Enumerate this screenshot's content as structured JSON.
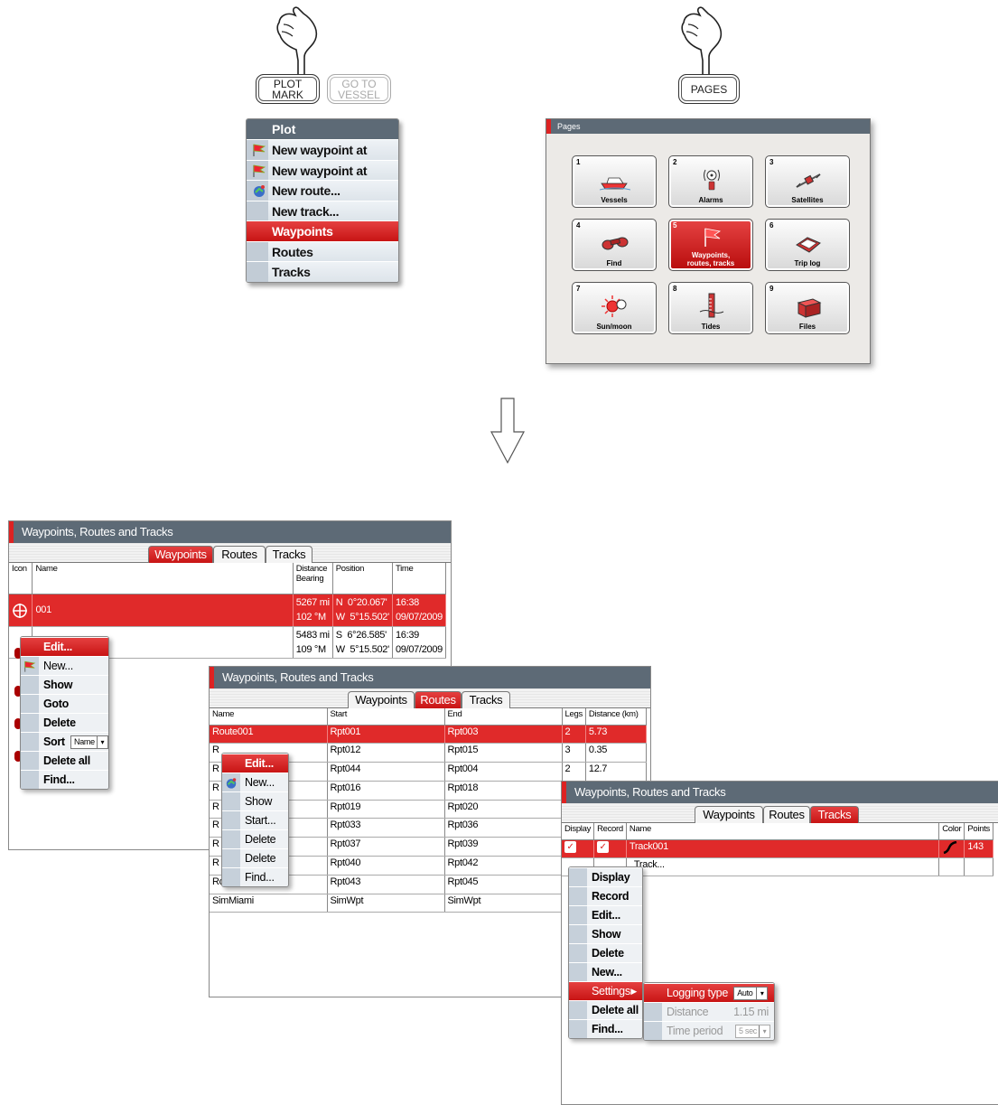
{
  "buttons": {
    "plot_mark": "PLOT\nMARK",
    "go_to_vessel": "GO TO\nVESSEL",
    "pages": "PAGES"
  },
  "plot_menu": {
    "title": "Plot",
    "items": [
      "New waypoint at cursor...",
      "New waypoint at vessel...",
      "New route...",
      "New track...",
      "Waypoints",
      "Routes",
      "Tracks"
    ]
  },
  "pages_panel": {
    "title": "Pages",
    "tiles": [
      {
        "num": "1",
        "label": "Vessels"
      },
      {
        "num": "2",
        "label": "Alarms"
      },
      {
        "num": "3",
        "label": "Satellites"
      },
      {
        "num": "4",
        "label": "Find"
      },
      {
        "num": "5",
        "label": "Waypoints,\nroutes, tracks"
      },
      {
        "num": "6",
        "label": "Trip log"
      },
      {
        "num": "7",
        "label": "Sun/moon"
      },
      {
        "num": "8",
        "label": "Tides"
      },
      {
        "num": "9",
        "label": "Files"
      }
    ]
  },
  "window_title": "Waypoints, Routes and Tracks",
  "tabs": [
    "Waypoints",
    "Routes",
    "Tracks"
  ],
  "waypoints": {
    "columns": [
      "Icon",
      "Name",
      "Distance\nBearing",
      "Position",
      "Time"
    ],
    "rows": [
      {
        "name": "001",
        "dist": "5267 mi",
        "bearing": "102 °M",
        "lat": "N  0°20.067'",
        "lon": "W  5°15.502'",
        "time": "16:38",
        "date": "09/07/2009"
      },
      {
        "name": "",
        "dist": "5483 mi",
        "bearing": "109 °M",
        "lat": "S  6°26.585'",
        "lon": "W  5°15.502'",
        "time": "16:39",
        "date": "09/07/2009"
      }
    ],
    "menu": [
      "Edit...",
      "New...",
      "Show",
      "Goto",
      "Delete",
      "Sort",
      "Delete all",
      "Find..."
    ],
    "sort_value": "Name"
  },
  "routes": {
    "columns": [
      "Name",
      "Start",
      "End",
      "Legs",
      "Distance (km)"
    ],
    "rows": [
      [
        "Route001",
        "Rpt001",
        "Rpt003",
        "2",
        "5.73"
      ],
      [
        "R",
        "Rpt012",
        "Rpt015",
        "3",
        "0.35"
      ],
      [
        "R",
        "Rpt044",
        "Rpt004",
        "2",
        "12.7"
      ],
      [
        "R",
        "Rpt016",
        "Rpt018",
        "",
        ""
      ],
      [
        "R",
        "Rpt019",
        "Rpt020",
        "",
        ""
      ],
      [
        "R",
        "Rpt033",
        "Rpt036",
        "",
        ""
      ],
      [
        "R",
        "Rpt037",
        "Rpt039",
        "",
        ""
      ],
      [
        "R",
        "Rpt040",
        "Rpt042",
        "",
        ""
      ],
      [
        "Route009",
        "Rpt043",
        "Rpt045",
        "",
        ""
      ],
      [
        "SimMiami",
        "SimWpt",
        "SimWpt",
        "",
        ""
      ]
    ],
    "menu": [
      "Edit...",
      "New...",
      "Show",
      "Start...",
      "Delete",
      "Delete all",
      "Find..."
    ]
  },
  "tracks": {
    "columns": [
      "Display",
      "Record",
      "Name",
      "Color",
      "Points"
    ],
    "rows": [
      {
        "name": "Track001",
        "points": "143"
      },
      {
        "name": "Track...",
        "points": ""
      }
    ],
    "menu": [
      "Display",
      "Record",
      "Edit...",
      "Show",
      "Delete",
      "New...",
      "Settings",
      "Delete all",
      "Find..."
    ],
    "settings": {
      "logging_type_label": "Logging type",
      "logging_type_value": "Auto",
      "distance_label": "Distance",
      "distance_value": "1.15 mi",
      "time_period_label": "Time period",
      "time_period_value": "5 sec"
    }
  },
  "colors": {
    "accent": "#d42020",
    "titlebar": "#5d6a76"
  }
}
